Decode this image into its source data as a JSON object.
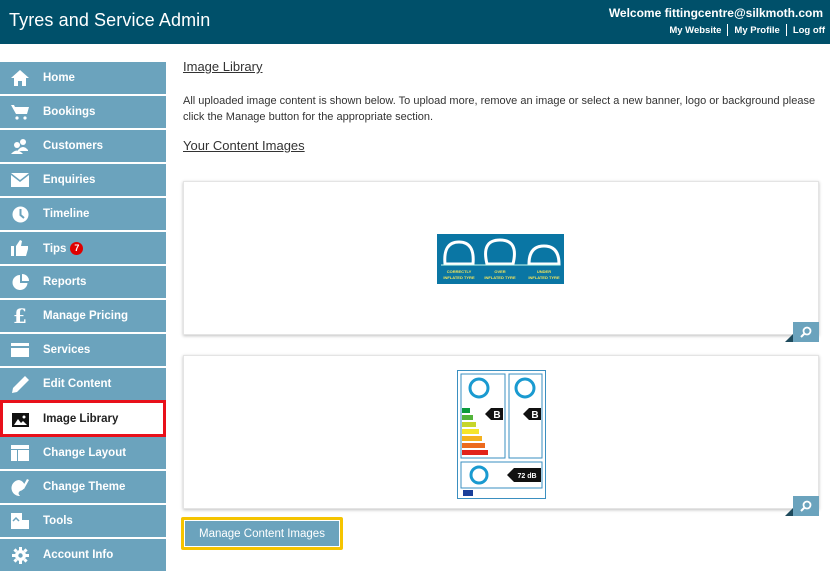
{
  "header": {
    "app_title": "Tyres and Service Admin",
    "welcome": "Welcome fittingcentre@silkmoth.com",
    "links": [
      "My Website",
      "My Profile",
      "Log off"
    ]
  },
  "sidebar": {
    "items": [
      {
        "label": "Home",
        "icon": "home-icon"
      },
      {
        "label": "Bookings",
        "icon": "cart-icon"
      },
      {
        "label": "Customers",
        "icon": "users-icon"
      },
      {
        "label": "Enquiries",
        "icon": "envelope-icon"
      },
      {
        "label": "Timeline",
        "icon": "clock-icon"
      },
      {
        "label": "Tips",
        "icon": "thumbs-up-icon",
        "badge": "7"
      },
      {
        "label": "Reports",
        "icon": "pie-chart-icon"
      },
      {
        "label": "Manage Pricing",
        "icon": "pound-icon"
      },
      {
        "label": "Services",
        "icon": "card-icon"
      },
      {
        "label": "Edit Content",
        "icon": "pencil-icon"
      },
      {
        "label": "Image Library",
        "icon": "image-icon",
        "active": true
      },
      {
        "label": "Change Layout",
        "icon": "layout-icon"
      },
      {
        "label": "Change Theme",
        "icon": "palette-icon"
      },
      {
        "label": "Tools",
        "icon": "tools-icon"
      },
      {
        "label": "Account Info",
        "icon": "gear-icon"
      }
    ]
  },
  "main": {
    "heading": "Image Library",
    "description": "All uploaded image content is shown below. To upload more, remove an image or select a new banner, logo or background please click the Manage button for the appropriate section.",
    "subheading": "Your Content Images",
    "images": [
      {
        "alt": "Tyre inflation diagram",
        "captions": [
          "CORRECTLY INFLATED TYRE",
          "OVER INFLATED TYRE",
          "UNDER INFLATED TYRE"
        ]
      },
      {
        "alt": "EU tyre label",
        "fuel_grade": "B",
        "wet_grip_grade": "B",
        "noise": "72 dB",
        "scale": [
          "A",
          "B",
          "C",
          "D",
          "E",
          "F",
          "G"
        ]
      }
    ],
    "manage_button": "Manage Content Images"
  },
  "colors": {
    "header_bg": "#00506a",
    "nav_bg": "#6ba3bd",
    "active_border": "#e8101a",
    "highlight_border": "#f5c400",
    "badge": "#e00000"
  }
}
